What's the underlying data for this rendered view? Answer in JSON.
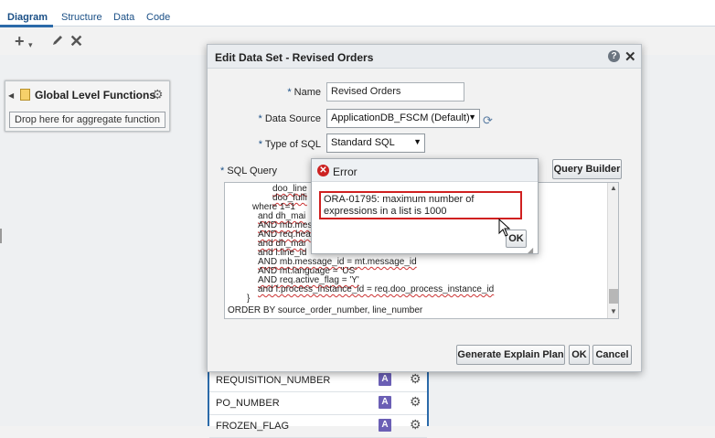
{
  "tabs": [
    {
      "label": "Diagram",
      "active": true
    },
    {
      "label": "Structure",
      "active": false
    },
    {
      "label": "Data",
      "active": false
    },
    {
      "label": "Code",
      "active": false
    }
  ],
  "toolbar": {
    "add_icon": "plus-icon",
    "add_arrow": "▾",
    "edit_icon": "pencil-icon",
    "delete_icon": "close-icon"
  },
  "global_functions": {
    "title": "Global Level Functions",
    "drop_hint": "Drop here for aggregate function"
  },
  "fields": [
    {
      "name": "REQUISITION_NUMBER",
      "type_glyph": "A"
    },
    {
      "name": "PO_NUMBER",
      "type_glyph": "A"
    },
    {
      "name": "FROZEN_FLAG",
      "type_glyph": "A"
    }
  ],
  "dialog": {
    "title": "Edit Data Set - Revised Orders",
    "name_label": "Name",
    "name_value": "Revised Orders",
    "data_source_label": "Data Source",
    "data_source_value": "ApplicationDB_FSCM (Default)",
    "sql_type_label": "Type of SQL",
    "sql_type_value": "Standard SQL",
    "sql_query_label": "SQL Query",
    "required_marker": "*",
    "query_builder_label": "Query Builder",
    "sql_lines": [
      "doo_line",
      "doo_fulfi",
      "where 1=1",
      "and dh_mai",
      "AND mb.mes",
      "AND req.hea",
      "and dh_mai",
      "and l.line_id",
      "AND mb.message_id = mt.message_id",
      "AND mt.language = 'US'",
      "AND req.active_flag = 'Y'",
      "and f.process_instance_id = req.doo_process_instance_id",
      "}",
      "ORDER BY source_order_number, line_number"
    ],
    "explain_label": "Generate Explain Plan",
    "ok_label": "OK",
    "cancel_label": "Cancel"
  },
  "error": {
    "title": "Error",
    "message": "ORA-01795: maximum number of expressions in a list is 1000",
    "ok_label": "OK"
  }
}
